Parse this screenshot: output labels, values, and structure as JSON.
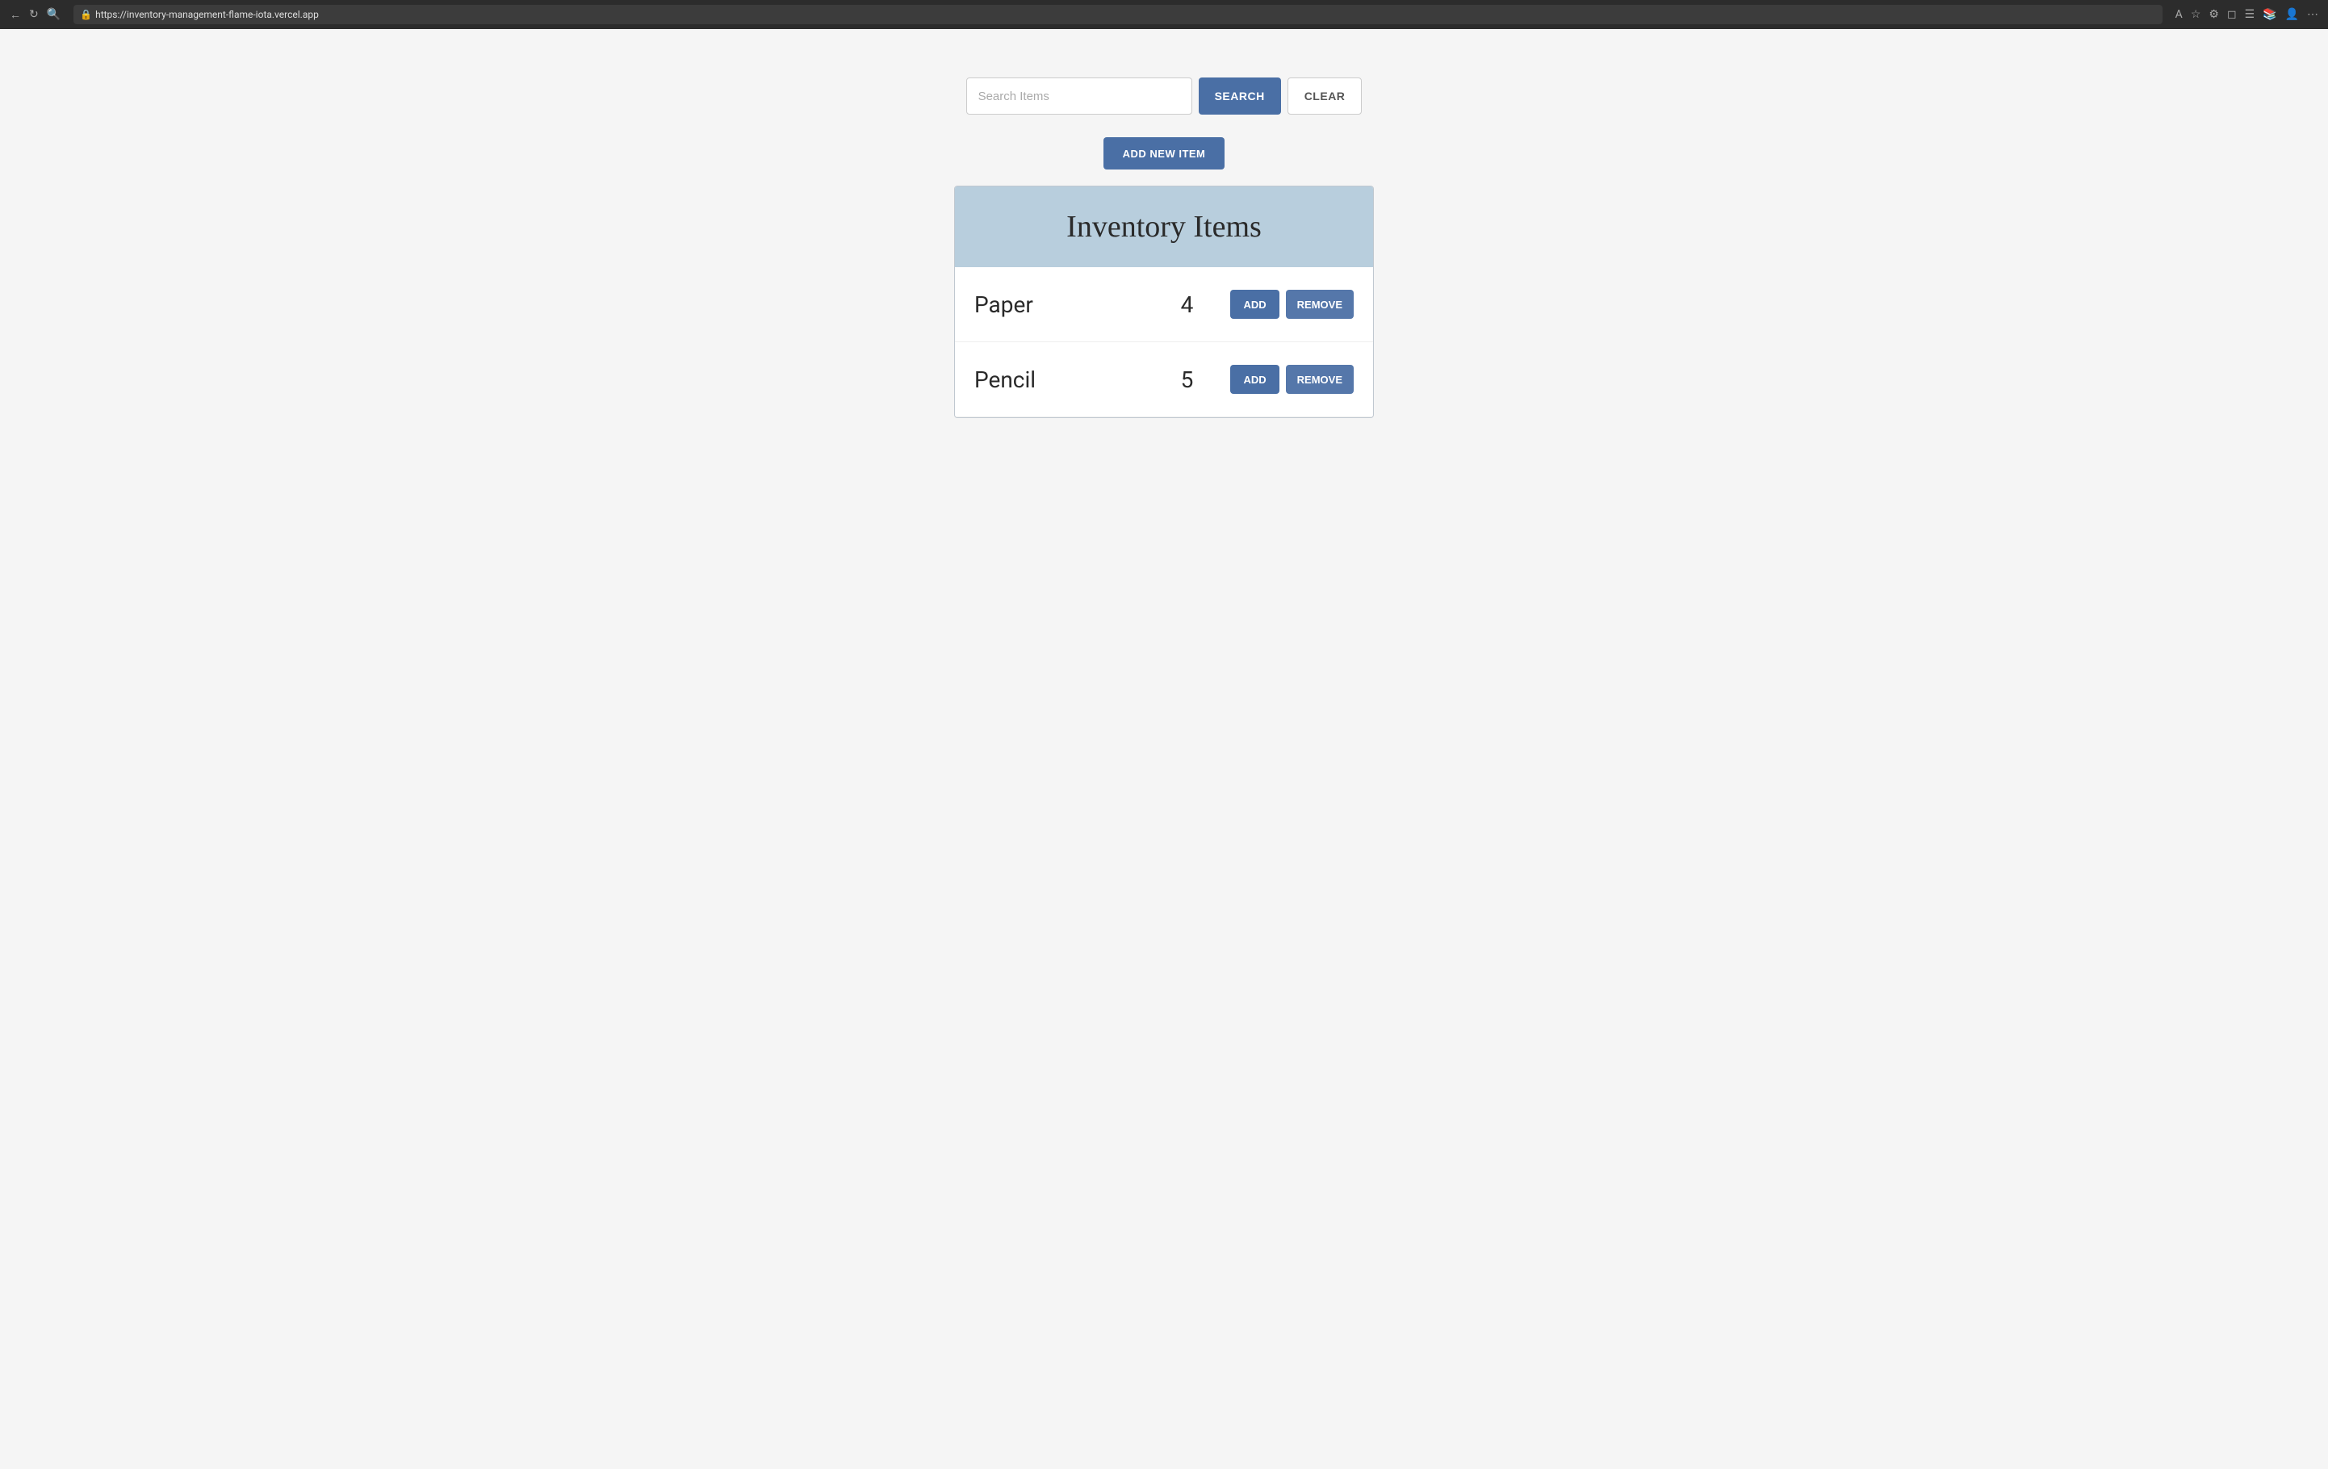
{
  "browser": {
    "url": "https://inventory-management-flame-iota.vercel.app"
  },
  "search": {
    "placeholder": "Search Items",
    "search_button": "SEARCH",
    "clear_button": "CLEAR"
  },
  "add_new_button": "ADD NEW ITEM",
  "inventory": {
    "title": "Inventory Items",
    "items": [
      {
        "name": "Paper",
        "quantity": "4",
        "add_label": "ADD",
        "remove_label": "REMOVE"
      },
      {
        "name": "Pencil",
        "quantity": "5",
        "add_label": "ADD",
        "remove_label": "REMOVE"
      }
    ]
  }
}
